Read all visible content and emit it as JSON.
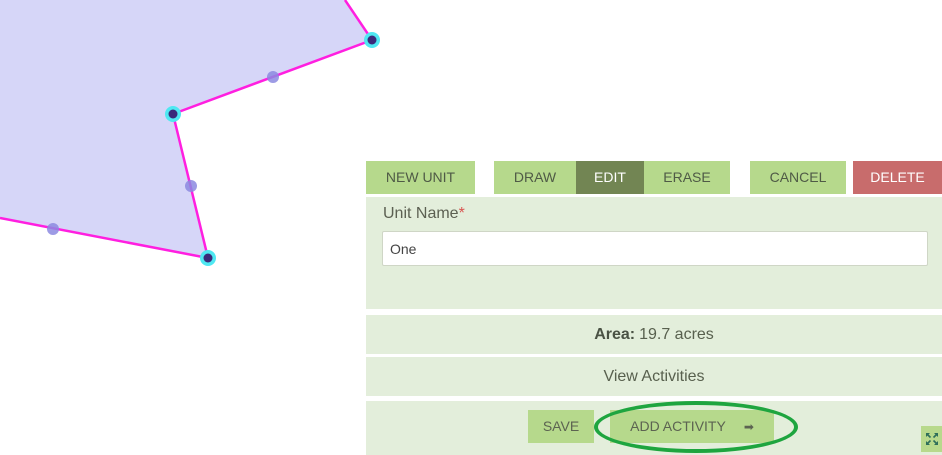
{
  "toolbar": {
    "new_unit": "NEW UNIT",
    "draw": "DRAW",
    "edit": "EDIT",
    "erase": "ERASE",
    "cancel": "CANCEL",
    "delete": "DELETE"
  },
  "unit_form": {
    "label": "Unit Name",
    "required_mark": "*",
    "value": "One"
  },
  "area": {
    "label": "Area:",
    "value": "19.7 acres"
  },
  "view_activities": "View Activities",
  "actions": {
    "save": "SAVE",
    "add_activity": "ADD ACTIVITY",
    "add_activity_icon": "arrow-right-icon"
  },
  "colors": {
    "polygon_fill": "#d6d6f8",
    "polygon_edge": "#ff1fe0",
    "vertex_halo": "#4fe8f2",
    "button_green": "#b6d98c",
    "active_green": "#728553",
    "delete_red": "#c86c6c",
    "panel_bg": "#e3eedb",
    "highlight_green": "#1ea53f"
  }
}
